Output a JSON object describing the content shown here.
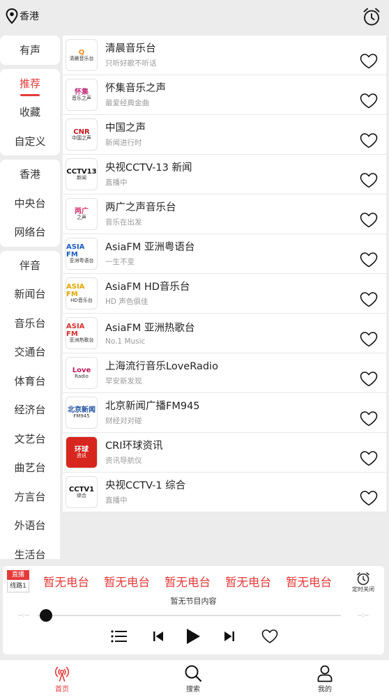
{
  "topbar": {
    "location": "香港",
    "location_icon": "location-pin-icon",
    "alarm_icon": "alarm-clock-icon"
  },
  "sidebar": {
    "groups": [
      [
        {
          "label": "有声",
          "active": false
        }
      ],
      [
        {
          "label": "推荐",
          "active": true
        },
        {
          "label": "收藏",
          "active": false
        },
        {
          "label": "自定义",
          "active": false
        }
      ],
      [
        {
          "label": "香港",
          "active": false
        },
        {
          "label": "中央台",
          "active": false
        },
        {
          "label": "网络台",
          "active": false
        }
      ],
      [
        {
          "label": "伴音",
          "active": false
        },
        {
          "label": "新闻台",
          "active": false
        },
        {
          "label": "音乐台",
          "active": false
        },
        {
          "label": "交通台",
          "active": false
        },
        {
          "label": "体育台",
          "active": false
        },
        {
          "label": "经济台",
          "active": false
        },
        {
          "label": "文艺台",
          "active": false
        },
        {
          "label": "曲艺台",
          "active": false
        },
        {
          "label": "方言台",
          "active": false
        },
        {
          "label": "外语台",
          "active": false
        },
        {
          "label": "生活台",
          "active": false
        }
      ]
    ],
    "accent_color": "#e53a3a"
  },
  "stations": [
    {
      "title": "清晨音乐台",
      "subtitle": "只听好歌不听话",
      "logo": {
        "line1": "Q",
        "line2": "清晨音乐台",
        "color": "#f28a1e",
        "bg": "#ffffff"
      }
    },
    {
      "title": "怀集音乐之声",
      "subtitle": "最爱经典金曲",
      "logo": {
        "line1": "怀集",
        "line2": "音乐之声",
        "color": "#c2307a",
        "bg": "#ffffff"
      }
    },
    {
      "title": "中国之声",
      "subtitle": "新闻进行时",
      "logo": {
        "line1": "CNR",
        "line2": "中国之声",
        "color": "#c8161d",
        "bg": "#ffffff"
      }
    },
    {
      "title": "央视CCTV-13 新闻",
      "subtitle": "直播中",
      "logo": {
        "line1": "CCTV13",
        "line2": "新闻",
        "color": "#111111",
        "bg": "#ffffff"
      }
    },
    {
      "title": "两广之声音乐台",
      "subtitle": "音乐在出发",
      "logo": {
        "line1": "两广",
        "line2": "之声",
        "color": "#d6336c",
        "bg": "#ffffff"
      }
    },
    {
      "title": "AsiaFM 亚洲粤语台",
      "subtitle": "一生不变",
      "logo": {
        "line1": "ASIA FM",
        "line2": "亚洲粤语台",
        "color": "#1f5fbf",
        "bg": "#ffffff"
      }
    },
    {
      "title": "AsiaFM HD音乐台",
      "subtitle": "HD 声色俱佳",
      "logo": {
        "line1": "ASIA FM",
        "line2": "HD音乐台",
        "color": "#e0a800",
        "bg": "#ffffff"
      }
    },
    {
      "title": "AsiaFM 亚洲热歌台",
      "subtitle": "No.1 Music",
      "logo": {
        "line1": "ASIA FM",
        "line2": "亚洲热歌台",
        "color": "#d32f2f",
        "bg": "#ffffff"
      }
    },
    {
      "title": "上海流行音乐LoveRadio",
      "subtitle": "早安新发现",
      "logo": {
        "line1": "Love",
        "line2": "Radio",
        "color": "#c2185b",
        "bg": "#ffffff"
      }
    },
    {
      "title": "北京新闻广播FM945",
      "subtitle": "财经对对碰",
      "logo": {
        "line1": "北京新闻",
        "line2": "FM945",
        "color": "#1d4e9e",
        "bg": "#ffffff"
      }
    },
    {
      "title": "CRI环球资讯",
      "subtitle": "资讯导航仪",
      "logo": {
        "line1": "环球",
        "line2": "资讯",
        "color": "#ffffff",
        "bg": "#d7261e"
      }
    },
    {
      "title": "央视CCTV-1 综合",
      "subtitle": "直播中",
      "logo": {
        "line1": "CCTV1",
        "line2": "综合",
        "color": "#111111",
        "bg": "#ffffff"
      }
    }
  ],
  "player": {
    "live_badge": "直播",
    "line_badge": "线路1",
    "marquee": [
      "暂无电台",
      "暂无电台",
      "暂无电台",
      "暂无电台",
      "暂无电台"
    ],
    "timer_label": "定时关闭",
    "now_playing": "暂无节目内容",
    "time_left": "--:--",
    "time_right": "--:--",
    "progress": 0
  },
  "bottom_nav": [
    {
      "label": "首页",
      "icon": "radio-icon",
      "active": true
    },
    {
      "label": "搜索",
      "icon": "search-icon",
      "active": false
    },
    {
      "label": "我的",
      "icon": "user-icon",
      "active": false
    }
  ]
}
